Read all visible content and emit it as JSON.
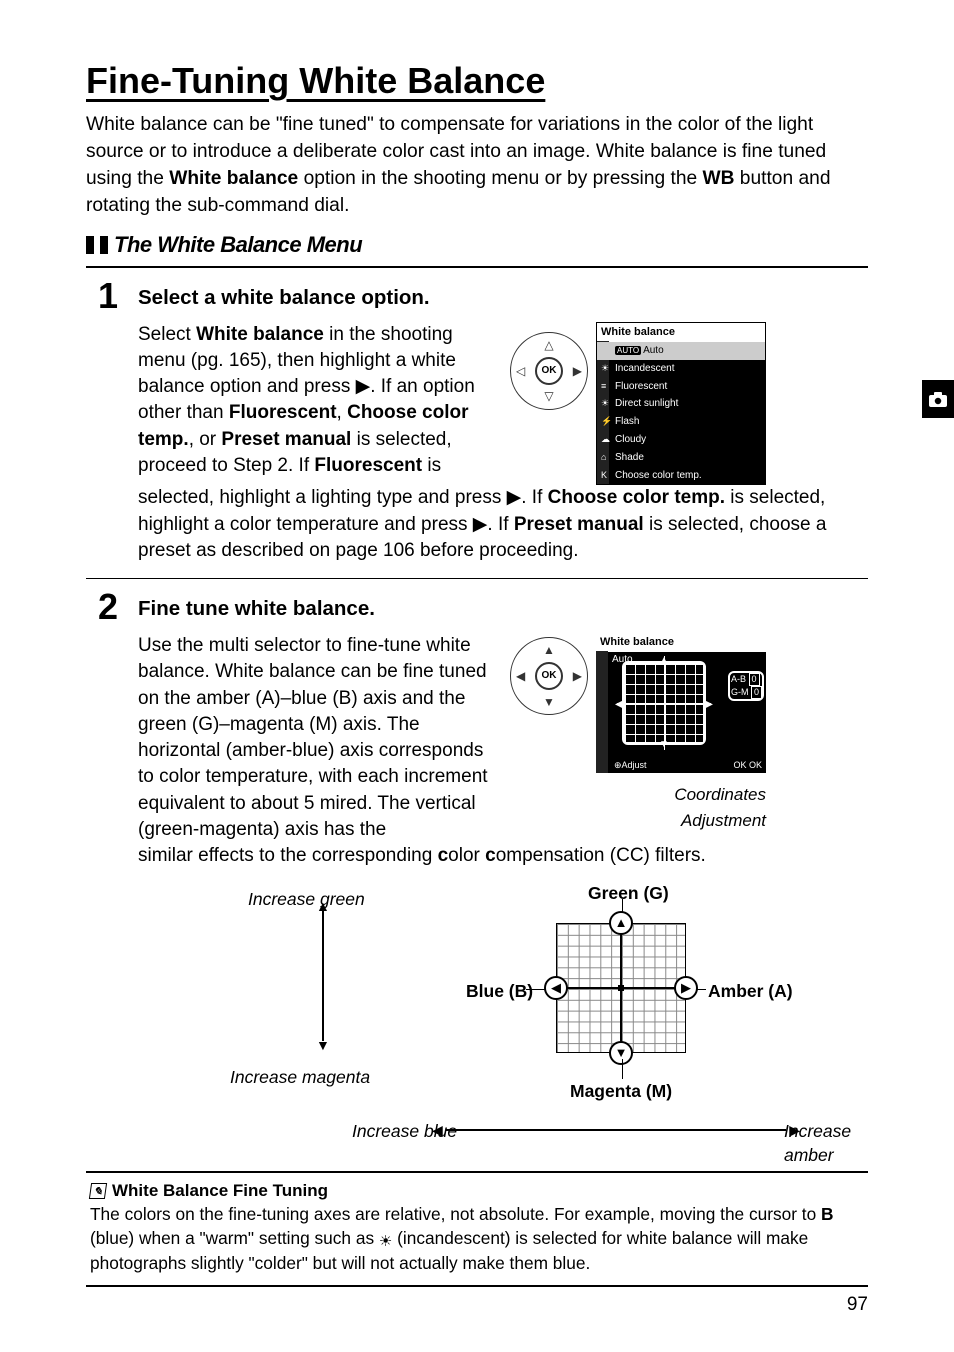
{
  "page_number": "97",
  "title": "Fine-Tuning White Balance",
  "intro_parts": [
    "White balance can be \"fine tuned\" to compensate for variations in the color of the light source or to introduce a deliberate color cast into an image.  White balance is fine tuned using the ",
    "White balance",
    " option in the shooting menu or by pressing the ",
    "WB",
    " button and rotating the sub-command dial."
  ],
  "section_header": "The White Balance Menu",
  "steps": {
    "1": {
      "title": "Select a white balance option.",
      "p_pre": "Select ",
      "p_bold1": "White balance",
      "p_mid1": " in the shooting menu (pg. 165), then highlight a white balance option and press ▶.  If an option other than ",
      "p_bold2": "Fluorescent",
      "p_mid2": ", ",
      "p_bold3": "Choose color temp.",
      "p_mid3": ", or ",
      "p_bold4": "Preset manual",
      "p_mid4": " is selected, proceed to Step 2.  If ",
      "p_bold5": "Fluorescent",
      "p_mid5": " is selected, highlight a lighting type and press ▶.  If ",
      "p_bold6": "Choose color temp.",
      "p_mid6": " is selected, highlight a color temperature and press ▶.  If ",
      "p_bold7": "Preset manual",
      "p_mid7": " is selected, choose a preset as described on page 106 before proceeding."
    },
    "2": {
      "title": "Fine tune white balance.",
      "p_pre": "Use the multi selector to fine-tune white balance.  White balance can be fine tuned on the amber (A)–blue (B) axis and the green (G)–magenta (M) axis.  The horizontal (amber-blue) axis corresponds to color temperature, with each increment equivalent to about 5 mired.  The vertical (green-magenta) axis has the similar effects to the corresponding ",
      "p_bold1": "c",
      "p_mid1": "olor ",
      "p_bold2": "c",
      "p_mid2": "ompensation (CC) filters."
    }
  },
  "lcd1": {
    "title": "White balance",
    "items": [
      {
        "icon": "AUTO",
        "label": "Auto",
        "selected": true
      },
      {
        "icon": "☀",
        "label": "Incandescent"
      },
      {
        "icon": "≡",
        "label": "Fluorescent"
      },
      {
        "icon": "☀",
        "label": "Direct sunlight"
      },
      {
        "icon": "⚡",
        "label": "Flash"
      },
      {
        "icon": "☁",
        "label": "Cloudy"
      },
      {
        "icon": "⌂",
        "label": "Shade"
      },
      {
        "icon": "K",
        "label": "Choose color temp."
      }
    ]
  },
  "lcd2": {
    "title": "White balance",
    "auto": "Auto",
    "ab_label": "A-B",
    "ab_value": "0",
    "gm_label": "G-M",
    "gm_value": "0",
    "foot_left": "⊕Adjust",
    "foot_right": "OK OK",
    "caption_coord": "Coordinates",
    "caption_adj": "Adjustment"
  },
  "diagram": {
    "increase_green": "Increase green",
    "increase_magenta": "Increase magenta",
    "increase_blue": "Increase blue",
    "increase_amber": "Increase amber",
    "green": "Green (G)",
    "magenta": "Magenta (M)",
    "blue": "Blue (B)",
    "amber": "Amber (A)"
  },
  "note": {
    "title": "White Balance Fine Tuning",
    "body_parts": [
      "The colors on the fine-tuning axes are relative, not absolute.  For example, moving the cursor to ",
      "B",
      " (blue) when a \"warm\" setting such as ",
      " (incandescent) is selected for white balance will make photographs slightly \"colder\" but will not actually make them blue."
    ]
  }
}
